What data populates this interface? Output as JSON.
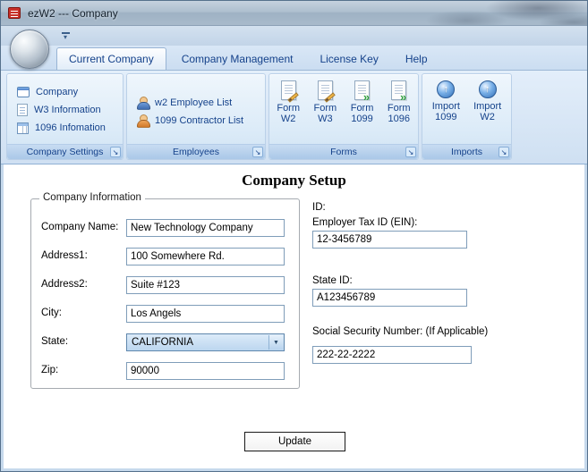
{
  "window": {
    "title": "ezW2 --- Company"
  },
  "icons": {
    "qat_arrow": "▾",
    "dialog_launcher": "↘",
    "combo_arrow": "▼",
    "import_arrow": "↑",
    "form_arrows": "»"
  },
  "tabs": [
    {
      "label": "Current Company",
      "active": true
    },
    {
      "label": "Company Management",
      "active": false
    },
    {
      "label": "License Key",
      "active": false
    },
    {
      "label": "Help",
      "active": false
    }
  ],
  "ribbon": {
    "groups": [
      {
        "label": "Company Settings",
        "items": [
          "Company",
          "W3 Information",
          "1096 Infomation"
        ]
      },
      {
        "label": "Employees",
        "items": [
          "w2 Employee List",
          "1099 Contractor List"
        ]
      },
      {
        "label": "Forms",
        "items": [
          {
            "top": "Form",
            "bottom": "W2"
          },
          {
            "top": "Form",
            "bottom": "W3"
          },
          {
            "top": "Form",
            "bottom": "1099"
          },
          {
            "top": "Form",
            "bottom": "1096"
          }
        ]
      },
      {
        "label": "Imports",
        "items": [
          {
            "top": "Import",
            "bottom": "1099"
          },
          {
            "top": "Import",
            "bottom": "W2"
          }
        ]
      }
    ]
  },
  "main": {
    "heading": "Company Setup",
    "company_info": {
      "legend": "Company Information",
      "fields": [
        {
          "label": "Company Name:",
          "value": "New Technology Company"
        },
        {
          "label": "Address1:",
          "value": "100 Somewhere Rd."
        },
        {
          "label": "Address2:",
          "value": "Suite #123"
        },
        {
          "label": "City:",
          "value": "Los Angels"
        },
        {
          "label": "State:",
          "value": "CALIFORNIA"
        },
        {
          "label": "Zip:",
          "value": "90000"
        }
      ]
    },
    "ids": {
      "heading": "ID:",
      "fields": [
        {
          "label": "Employer Tax ID (EIN):",
          "value": "12-3456789"
        },
        {
          "label": "State ID:",
          "value": "A123456789"
        },
        {
          "label": "Social Security Number: (If Applicable)",
          "value": "222-22-2222"
        }
      ]
    },
    "update_label": "Update"
  }
}
